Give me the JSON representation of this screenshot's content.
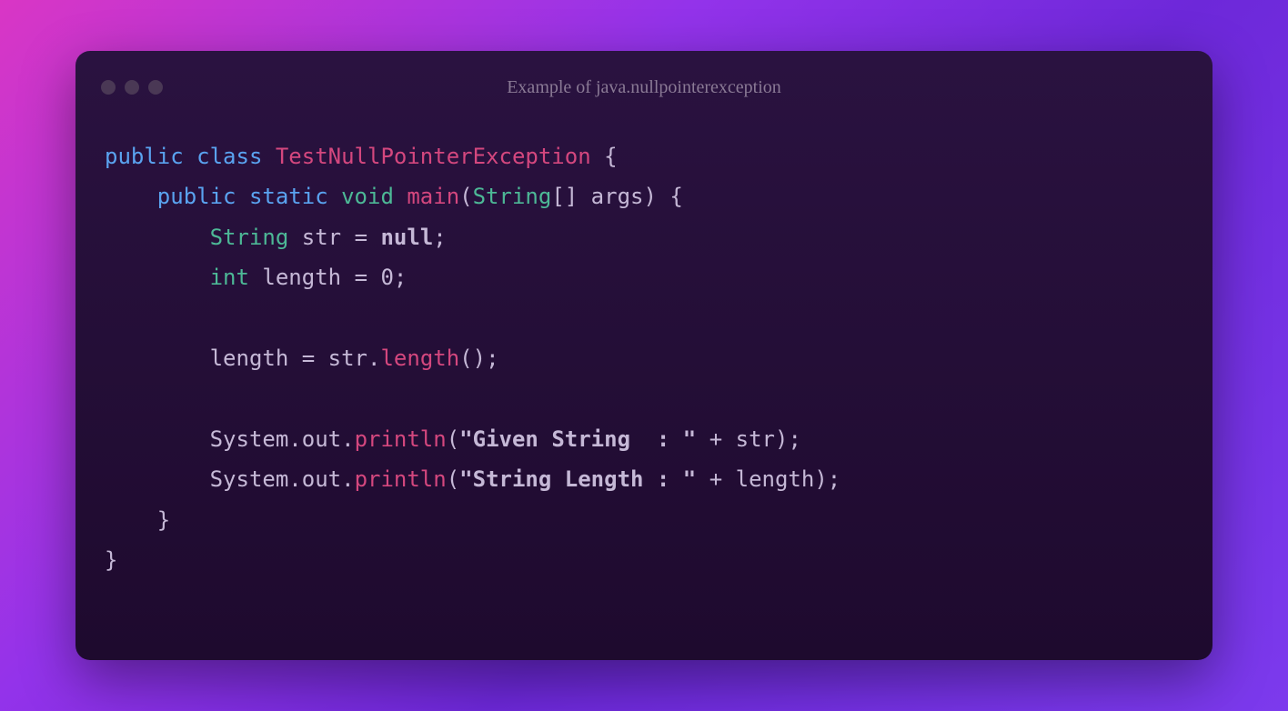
{
  "window": {
    "title": "Example of java.nullpointerexception"
  },
  "code": {
    "tokens": {
      "public1": "public",
      "class": "class",
      "className": "TestNullPointerException",
      "braceOpen1": "{",
      "public2": "public",
      "static": "static",
      "void": "void",
      "main": "main",
      "parenOpen1": "(",
      "string": "String",
      "brackets": "[]",
      "args": "args",
      "parenClose1": ")",
      "braceOpen2": "{",
      "string2": "String",
      "str": "str",
      "eq1": "=",
      "null": "null",
      "semi1": ";",
      "int": "int",
      "lengthVar": "length",
      "eq2": "=",
      "zero": "0",
      "semi2": ";",
      "lengthVar2": "length",
      "eq3": "=",
      "str2": "str",
      "dot1": ".",
      "lengthMethod": "length",
      "parens1": "()",
      "semi3": ";",
      "system1": "System",
      "dot2": ".",
      "out1": "out",
      "dot3": ".",
      "println1": "println",
      "parenOpen2": "(",
      "strLit1": "\"Given String  : \"",
      "plus1": "+",
      "str3": "str",
      "parenClose2": ")",
      "semi4": ";",
      "system2": "System",
      "dot4": ".",
      "out2": "out",
      "dot5": ".",
      "println2": "println",
      "parenOpen3": "(",
      "strLit2": "\"String Length : \"",
      "plus2": "+",
      "lengthVar3": "length",
      "parenClose3": ")",
      "semi5": ";",
      "braceClose1": "}",
      "braceClose2": "}"
    }
  }
}
